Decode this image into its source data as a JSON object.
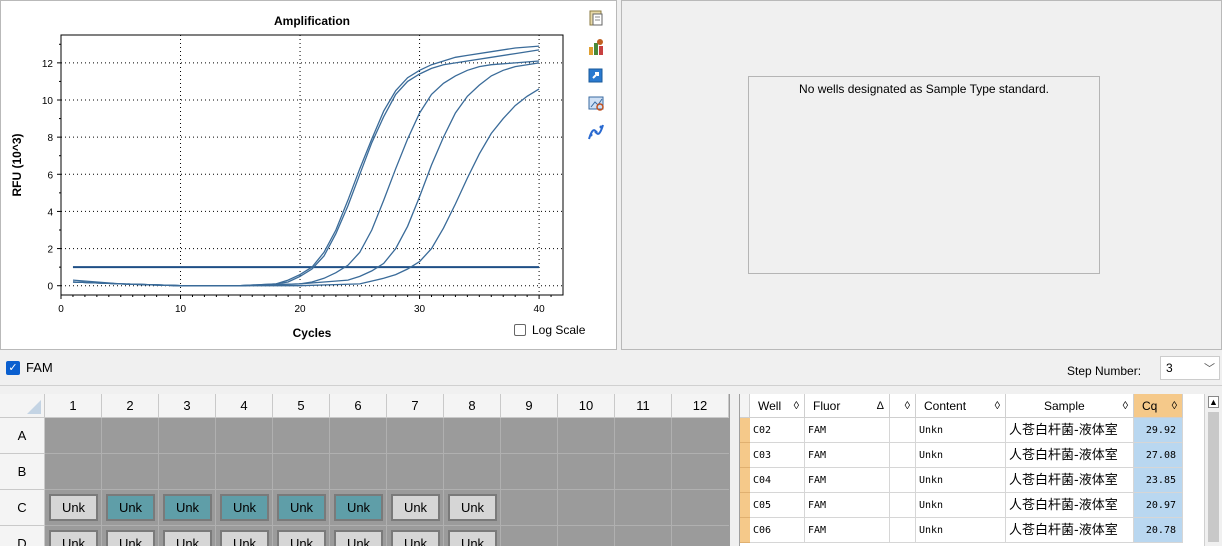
{
  "chart": {
    "title": "Amplification",
    "xlabel": "Cycles",
    "ylabel": "RFU (10^3)",
    "log_scale_label": "Log Scale",
    "log_scale_checked": false,
    "icons": [
      "copy-icon",
      "chart-settings-icon",
      "export-icon",
      "zoom-icon",
      "curve-icon"
    ]
  },
  "chart_data": {
    "type": "line",
    "title": "Amplification",
    "xlabel": "Cycles",
    "ylabel": "RFU (10^3)",
    "xlim": [
      0,
      42
    ],
    "ylim": [
      -0.5,
      13.5
    ],
    "xticks": [
      0,
      10,
      20,
      30,
      40
    ],
    "yticks": [
      0,
      2,
      4,
      6,
      8,
      10,
      12
    ],
    "grid": "dotted",
    "threshold": 1.0,
    "color": "#3a6b99",
    "series": [
      {
        "cq": 20.78,
        "x": [
          1,
          5,
          10,
          15,
          18,
          19,
          20,
          21,
          22,
          23,
          24,
          25,
          26,
          27,
          28,
          29,
          30,
          31,
          32,
          33,
          34,
          36,
          38,
          40
        ],
        "y": [
          0.2,
          0.1,
          0.0,
          0.0,
          0.1,
          0.3,
          0.6,
          1.0,
          1.8,
          3.0,
          4.6,
          6.3,
          7.9,
          9.4,
          10.5,
          11.2,
          11.6,
          11.9,
          12.1,
          12.3,
          12.4,
          12.6,
          12.8,
          12.9
        ]
      },
      {
        "cq": 20.97,
        "x": [
          1,
          5,
          10,
          15,
          18,
          19,
          20,
          21,
          22,
          23,
          24,
          25,
          26,
          27,
          28,
          29,
          30,
          31,
          32,
          33,
          34,
          36,
          38,
          40
        ],
        "y": [
          0.3,
          0.1,
          0.0,
          0.0,
          0.1,
          0.2,
          0.5,
          0.9,
          1.6,
          2.8,
          4.3,
          6.0,
          7.7,
          9.1,
          10.3,
          11.0,
          11.4,
          11.7,
          11.9,
          12.0,
          12.1,
          12.3,
          12.5,
          12.7
        ]
      },
      {
        "cq": 23.85,
        "x": [
          1,
          5,
          10,
          15,
          20,
          21,
          22,
          23,
          24,
          25,
          26,
          27,
          28,
          29,
          30,
          31,
          32,
          33,
          34,
          35,
          36,
          38,
          40
        ],
        "y": [
          0.2,
          0.1,
          0.0,
          0.0,
          0.1,
          0.2,
          0.4,
          0.7,
          1.1,
          1.8,
          3.0,
          4.6,
          6.3,
          7.9,
          9.3,
          10.3,
          10.9,
          11.3,
          11.6,
          11.8,
          11.9,
          12.0,
          12.1
        ]
      },
      {
        "cq": 27.08,
        "x": [
          1,
          5,
          10,
          15,
          20,
          24,
          25,
          26,
          27,
          28,
          29,
          30,
          31,
          32,
          33,
          34,
          35,
          36,
          37,
          38,
          40
        ],
        "y": [
          0.2,
          0.1,
          0.0,
          0.0,
          0.1,
          0.3,
          0.5,
          0.8,
          1.2,
          2.0,
          3.2,
          4.8,
          6.5,
          8.0,
          9.3,
          10.2,
          10.8,
          11.3,
          11.6,
          11.8,
          12.0
        ]
      },
      {
        "cq": 29.92,
        "x": [
          1,
          5,
          10,
          15,
          20,
          25,
          27,
          28,
          29,
          30,
          31,
          32,
          33,
          34,
          35,
          36,
          37,
          38,
          39,
          40
        ],
        "y": [
          0.2,
          0.1,
          0.0,
          0.0,
          0.0,
          0.1,
          0.4,
          0.6,
          0.9,
          1.3,
          2.0,
          3.1,
          4.4,
          5.8,
          7.1,
          8.2,
          9.0,
          9.7,
          10.2,
          10.6
        ]
      }
    ]
  },
  "std_curve": {
    "message": "No wells designated as Sample Type standard."
  },
  "fluor_bar": {
    "fluor": "FAM",
    "fluor_checked": true,
    "step_label": "Step Number:",
    "step_value": "3"
  },
  "plate": {
    "columns": [
      "1",
      "2",
      "3",
      "4",
      "5",
      "6",
      "7",
      "8",
      "9",
      "10",
      "11",
      "12"
    ],
    "rows": [
      "A",
      "B",
      "C",
      "D"
    ],
    "wells": [
      {
        "row": "C",
        "col": 1,
        "label": "Unk",
        "style": "gray"
      },
      {
        "row": "C",
        "col": 2,
        "label": "Unk",
        "style": "teal"
      },
      {
        "row": "C",
        "col": 3,
        "label": "Unk",
        "style": "teal"
      },
      {
        "row": "C",
        "col": 4,
        "label": "Unk",
        "style": "teal"
      },
      {
        "row": "C",
        "col": 5,
        "label": "Unk",
        "style": "teal"
      },
      {
        "row": "C",
        "col": 6,
        "label": "Unk",
        "style": "teal"
      },
      {
        "row": "C",
        "col": 7,
        "label": "Unk",
        "style": "gray"
      },
      {
        "row": "C",
        "col": 8,
        "label": "Unk",
        "style": "gray"
      },
      {
        "row": "D",
        "col": 1,
        "label": "Unk",
        "style": "gray"
      },
      {
        "row": "D",
        "col": 2,
        "label": "Unk",
        "style": "gray"
      },
      {
        "row": "D",
        "col": 3,
        "label": "Unk",
        "style": "gray"
      },
      {
        "row": "D",
        "col": 4,
        "label": "Unk",
        "style": "gray"
      },
      {
        "row": "D",
        "col": 5,
        "label": "Unk",
        "style": "gray"
      },
      {
        "row": "D",
        "col": 6,
        "label": "Unk",
        "style": "gray"
      },
      {
        "row": "D",
        "col": 7,
        "label": "Unk",
        "style": "gray"
      },
      {
        "row": "D",
        "col": 8,
        "label": "Unk",
        "style": "gray"
      }
    ]
  },
  "results_table": {
    "headers": [
      "Well",
      "Fluor",
      "",
      "Content",
      "Sample",
      "Cq"
    ],
    "rows": [
      {
        "well": "C02",
        "fluor": "FAM",
        "content": "Unkn",
        "sample": "人苍白杆菌-液体室",
        "cq": "29.92"
      },
      {
        "well": "C03",
        "fluor": "FAM",
        "content": "Unkn",
        "sample": "人苍白杆菌-液体室",
        "cq": "27.08"
      },
      {
        "well": "C04",
        "fluor": "FAM",
        "content": "Unkn",
        "sample": "人苍白杆菌-液体室",
        "cq": "23.85"
      },
      {
        "well": "C05",
        "fluor": "FAM",
        "content": "Unkn",
        "sample": "人苍白杆菌-液体室",
        "cq": "20.97"
      },
      {
        "well": "C06",
        "fluor": "FAM",
        "content": "Unkn",
        "sample": "人苍白杆菌-液体室",
        "cq": "20.78"
      }
    ]
  },
  "colors": {
    "curve": "#3a6b99",
    "well_teal": "#5f9ea8",
    "well_gray": "#d6d6d6",
    "plate_bg": "#9b9b9b",
    "cq_highlight": "#b9d7f0",
    "row_marker": "#f5c98a"
  }
}
